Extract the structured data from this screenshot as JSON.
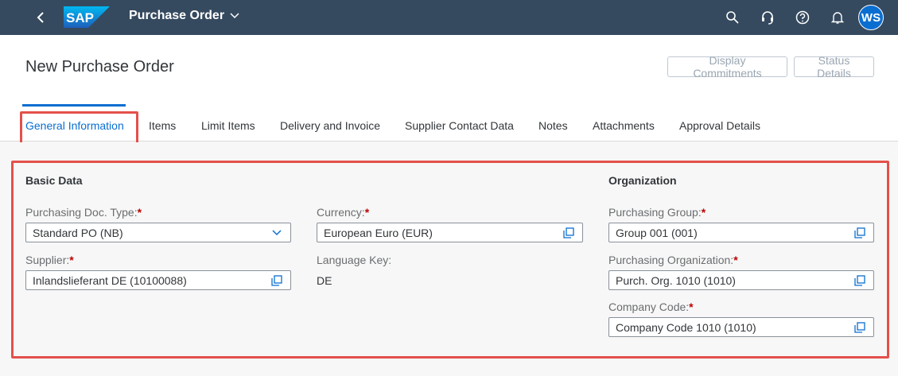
{
  "shell": {
    "brand": "SAP",
    "app_title": "Purchase Order",
    "avatar_initials": "WS"
  },
  "header": {
    "title": "New Purchase Order",
    "buttons": [
      "Display Commitments",
      "Status Details"
    ]
  },
  "tabs": [
    {
      "label": "General Information",
      "active": true
    },
    {
      "label": "Items"
    },
    {
      "label": "Limit Items"
    },
    {
      "label": "Delivery and Invoice"
    },
    {
      "label": "Supplier Contact Data"
    },
    {
      "label": "Notes"
    },
    {
      "label": "Attachments"
    },
    {
      "label": "Approval Details"
    }
  ],
  "basic_data": {
    "title": "Basic Data",
    "doc_type_label": "Purchasing Doc. Type:",
    "doc_type_value": "Standard PO (NB)",
    "supplier_label": "Supplier:",
    "supplier_value": "Inlandslieferant DE (10100088)",
    "currency_label": "Currency:",
    "currency_value": "European Euro (EUR)",
    "language_label": "Language Key:",
    "language_value": "DE"
  },
  "organization": {
    "title": "Organization",
    "group_label": "Purchasing Group:",
    "group_value": "Group 001 (001)",
    "org_label": "Purchasing Organization:",
    "org_value": "Purch. Org. 1010 (1010)",
    "company_label": "Company Code:",
    "company_value": "Company Code 1010 (1010)"
  },
  "required_marker": "*",
  "colors": {
    "shell_bg": "#354a5f",
    "accent": "#0a6ed1",
    "highlight": "#e4504a",
    "required": "#bb0000"
  }
}
